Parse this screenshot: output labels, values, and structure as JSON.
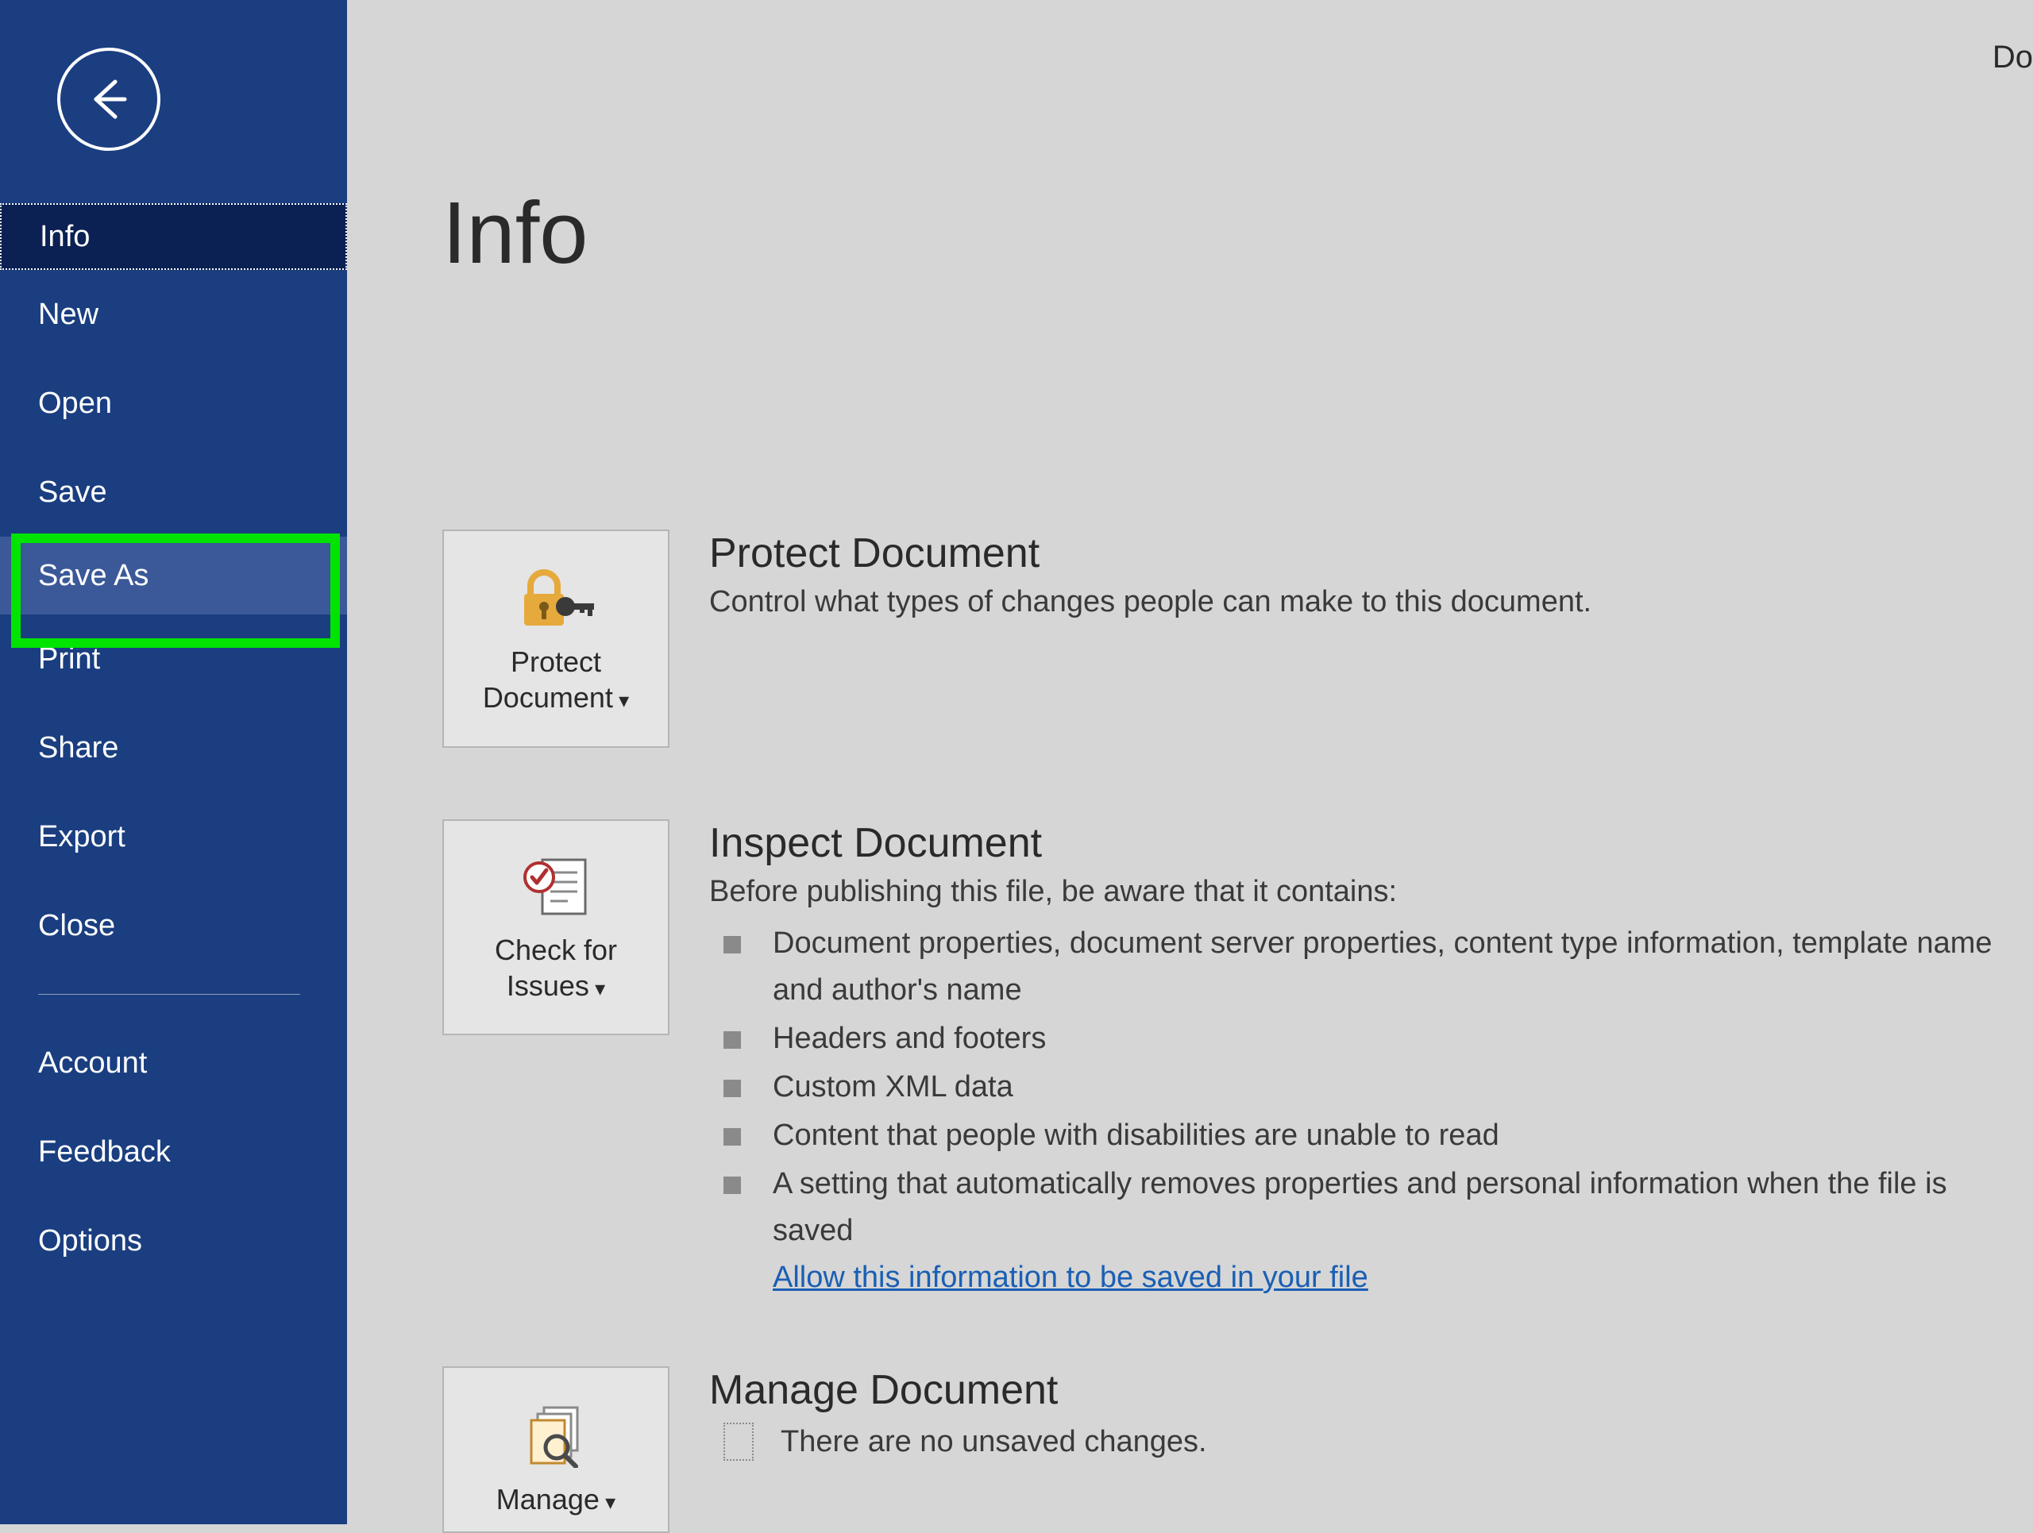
{
  "topRight": "Do",
  "sidebar": {
    "items": [
      {
        "label": "Info"
      },
      {
        "label": "New"
      },
      {
        "label": "Open"
      },
      {
        "label": "Save"
      },
      {
        "label": "Save As"
      },
      {
        "label": "Print"
      },
      {
        "label": "Share"
      },
      {
        "label": "Export"
      },
      {
        "label": "Close"
      }
    ],
    "bottom": [
      {
        "label": "Account"
      },
      {
        "label": "Feedback"
      },
      {
        "label": "Options"
      }
    ]
  },
  "content": {
    "title": "Info",
    "protect": {
      "button": "Protect\nDocument",
      "heading": "Protect Document",
      "desc": "Control what types of changes people can make to this document."
    },
    "inspect": {
      "button": "Check for\nIssues",
      "heading": "Inspect Document",
      "desc": "Before publishing this file, be aware that it contains:",
      "items": [
        "Document properties, document server properties, content type information, template name and author's name",
        "Headers and footers",
        "Custom XML data",
        "Content that people with disabilities are unable to read",
        "A setting that automatically removes properties and personal information when the file is saved"
      ],
      "link": "Allow this information to be saved in your file"
    },
    "manage": {
      "button": "Manage",
      "heading": "Manage Document",
      "desc": "There are no unsaved changes."
    }
  }
}
